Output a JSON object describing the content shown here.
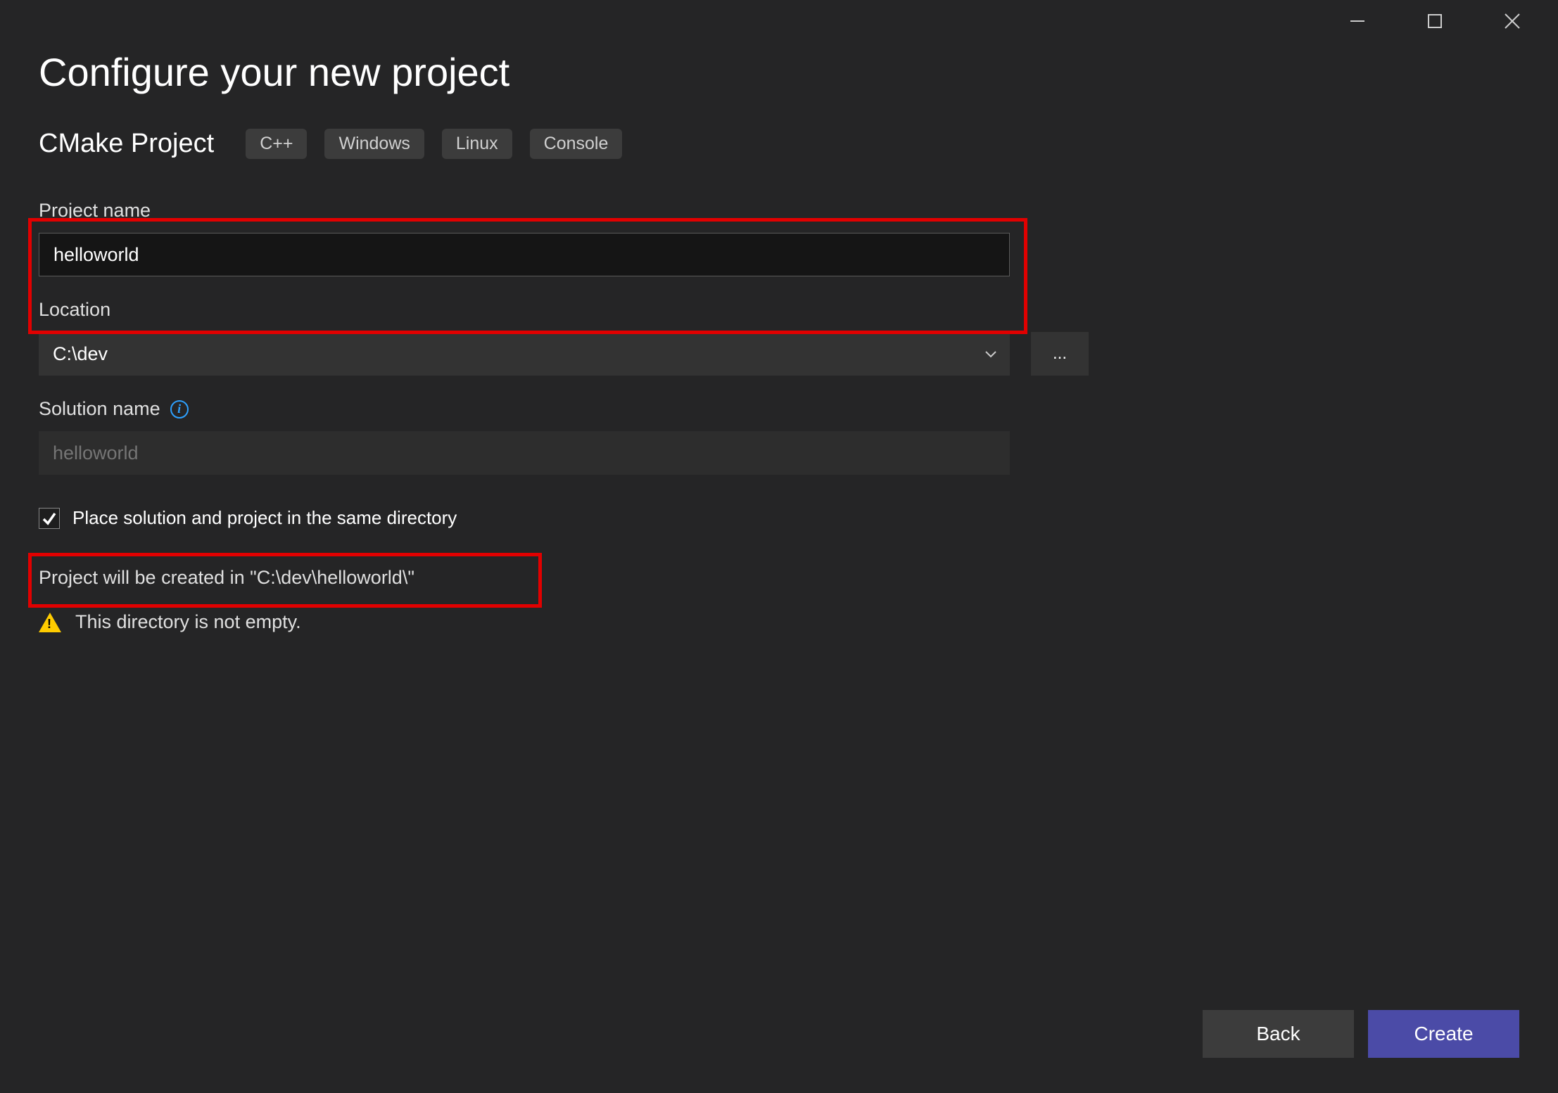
{
  "header": {
    "title": "Configure your new project"
  },
  "template": {
    "name": "CMake Project",
    "tags": [
      "C++",
      "Windows",
      "Linux",
      "Console"
    ]
  },
  "fields": {
    "project_name": {
      "label": "Project name",
      "value": "helloworld"
    },
    "location": {
      "label": "Location",
      "value": "C:\\dev",
      "browse": "..."
    },
    "solution_name": {
      "label": "Solution name",
      "placeholder": "helloworld"
    },
    "same_dir": {
      "label": "Place solution and project in the same directory",
      "checked": true
    }
  },
  "status": {
    "creation_path": "Project will be created in \"C:\\dev\\helloworld\\\"",
    "warning": "This directory is not empty."
  },
  "footer": {
    "back": "Back",
    "create": "Create"
  }
}
